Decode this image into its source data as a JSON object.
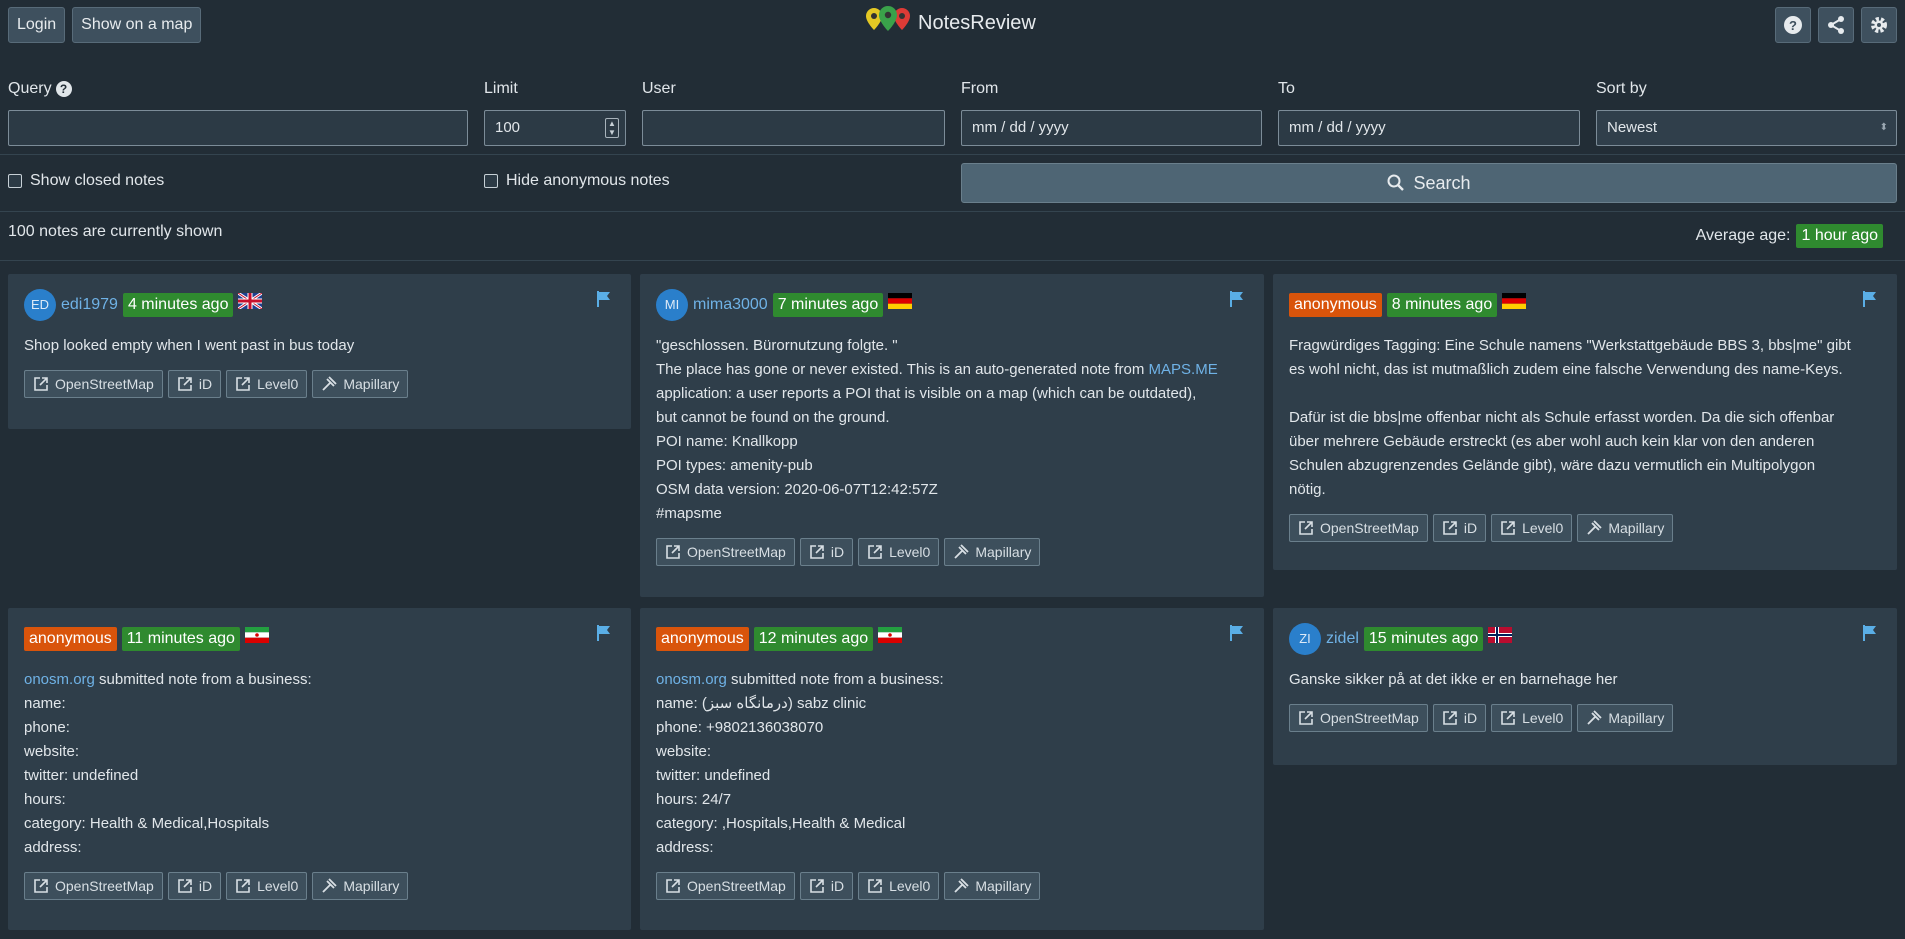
{
  "header": {
    "login": "Login",
    "show_map": "Show on a map",
    "title": "NotesReview"
  },
  "filters": {
    "query_label": "Query",
    "limit_label": "Limit",
    "limit_value": "100",
    "user_label": "User",
    "from_label": "From",
    "from_placeholder": "mm / dd / yyyy",
    "to_label": "To",
    "to_placeholder": "mm / dd / yyyy",
    "sort_label": "Sort by",
    "sort_value": "Newest",
    "show_closed": "Show closed notes",
    "hide_anonymous": "Hide anonymous notes",
    "search_label": "Search"
  },
  "summary": {
    "count_text": "100 notes are currently shown",
    "avg_label": "Average age:",
    "avg_value": "1 hour ago"
  },
  "colors": {
    "accent_green": "#2f8a2f",
    "anonymous_orange": "#d9540b",
    "link_blue": "#6fb2e6"
  },
  "actions": [
    "OpenStreetMap",
    "iD",
    "Level0",
    "Mapillary"
  ],
  "notes": [
    {
      "avatar": "ED",
      "user": "edi1979",
      "age": "4 minutes ago",
      "country": "gb",
      "lines": [
        "Shop looked empty when I went past in bus today"
      ]
    },
    {
      "avatar": "MI",
      "user": "mima3000",
      "age": "7 minutes ago",
      "country": "de",
      "lines": [
        "\"geschlossen. Bürornutzung folgte. \"",
        "The place has gone or never existed. This is an auto-generated note from ",
        "application: a user reports a POI that is visible on a map (which can be outdated),",
        "but cannot be found on the ground.",
        "POI name: Knallkopp",
        "POI types: amenity-pub",
        "OSM data version: 2020-06-07T12:42:57Z",
        "#mapsme"
      ],
      "link": "MAPS.ME"
    },
    {
      "user": "anonymous",
      "age": "8 minutes ago",
      "country": "de",
      "lines": [
        "Fragwürdiges Tagging: Eine Schule namens \"Werkstattgebäude BBS 3, bbs|me\" gibt",
        "es wohl nicht, das ist mutmaßlich zudem eine falsche Verwendung des name-Keys.",
        "",
        "Dafür ist die bbs|me offenbar nicht als Schule erfasst worden. Da die sich offenbar",
        "über mehrere Gebäude erstreckt (es aber wohl auch kein klar von den anderen",
        "Schulen abzugrenzendes Gelände gibt), wäre dazu vermutlich ein Multipolygon",
        "nötig."
      ]
    },
    {
      "user": "anonymous",
      "age": "11 minutes ago",
      "country": "ir",
      "link": "onosm.org",
      "lines": [
        " submitted note from a business:",
        "name:",
        "phone:",
        "website:",
        "twitter: undefined",
        "hours:",
        "category: Health & Medical,Hospitals",
        "address:"
      ]
    },
    {
      "user": "anonymous",
      "age": "12 minutes ago",
      "country": "ir",
      "link": "onosm.org",
      "lines": [
        " submitted note from a business:",
        "name: (درمانگاه سبز) sabz clinic",
        "phone: +9802136038070",
        "website:",
        "twitter: undefined",
        "hours: 24/7",
        "category: ,Hospitals,Health & Medical",
        "address:"
      ]
    },
    {
      "avatar": "ZI",
      "user": "zidel",
      "age": "15 minutes ago",
      "country": "no",
      "lines": [
        "Ganske sikker på at det ikke er en barnehage her"
      ]
    }
  ]
}
